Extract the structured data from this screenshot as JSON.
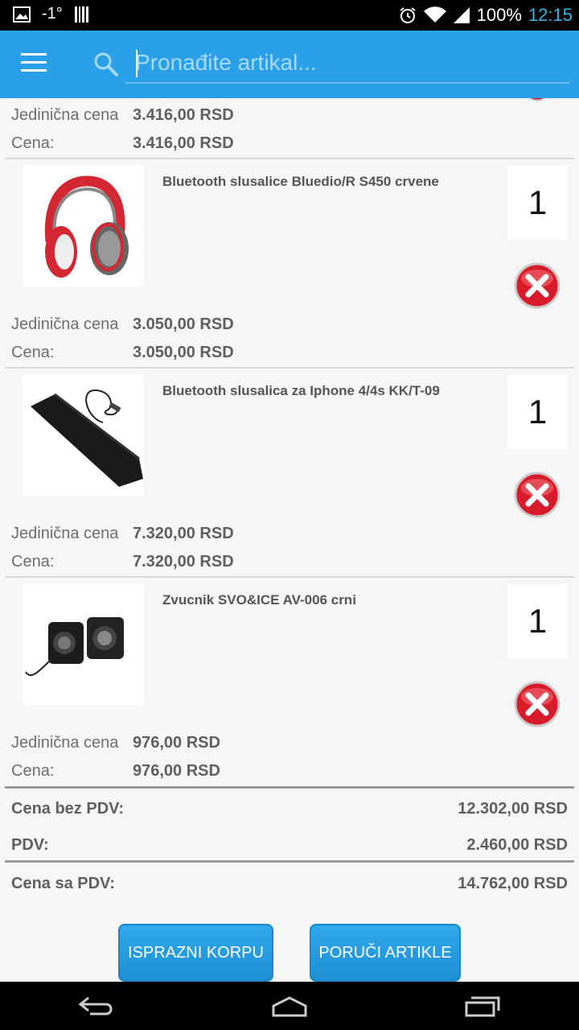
{
  "status_bar": {
    "signal_label": "-1°",
    "battery": "100%",
    "time": "12:15"
  },
  "search": {
    "placeholder": "Pronađite artikal..."
  },
  "top_partial_item": {
    "unit_price_label": "Jedinična cena",
    "unit_price": "3.416,00 RSD",
    "price_label": "Cena:",
    "price": "3.416,00 RSD"
  },
  "items": [
    {
      "name": "Bluetooth slusalice Bluedio/R S450 crvene",
      "qty": "1",
      "unit_price_label": "Jedinična cena",
      "unit_price": "3.050,00 RSD",
      "price_label": "Cena:",
      "price": "3.050,00 RSD"
    },
    {
      "name": "Bluetooth slusalica za Iphone 4/4s KK/T-09",
      "qty": "1",
      "unit_price_label": "Jedinična cena",
      "unit_price": "7.320,00 RSD",
      "price_label": "Cena:",
      "price": "7.320,00 RSD"
    },
    {
      "name": "Zvucnik SVO&ICE AV-006 crni",
      "qty": "1",
      "unit_price_label": "Jedinična cena",
      "unit_price": "976,00 RSD",
      "price_label": "Cena:",
      "price": "976,00 RSD"
    }
  ],
  "summary": {
    "net_label": "Cena bez PDV:",
    "net_value": "12.302,00 RSD",
    "vat_label": "PDV:",
    "vat_value": "2.460,00 RSD",
    "gross_label": "Cena sa PDV:",
    "gross_value": "14.762,00 RSD"
  },
  "buttons": {
    "empty_cart": "ISPRAZNI KORPU",
    "order": "PORUČI ARTIKLE"
  },
  "colors": {
    "app_bar": "#2aa0e8",
    "button": "#1f8fd2",
    "clock": "#33b5e5",
    "remove": "#d81b2a"
  }
}
